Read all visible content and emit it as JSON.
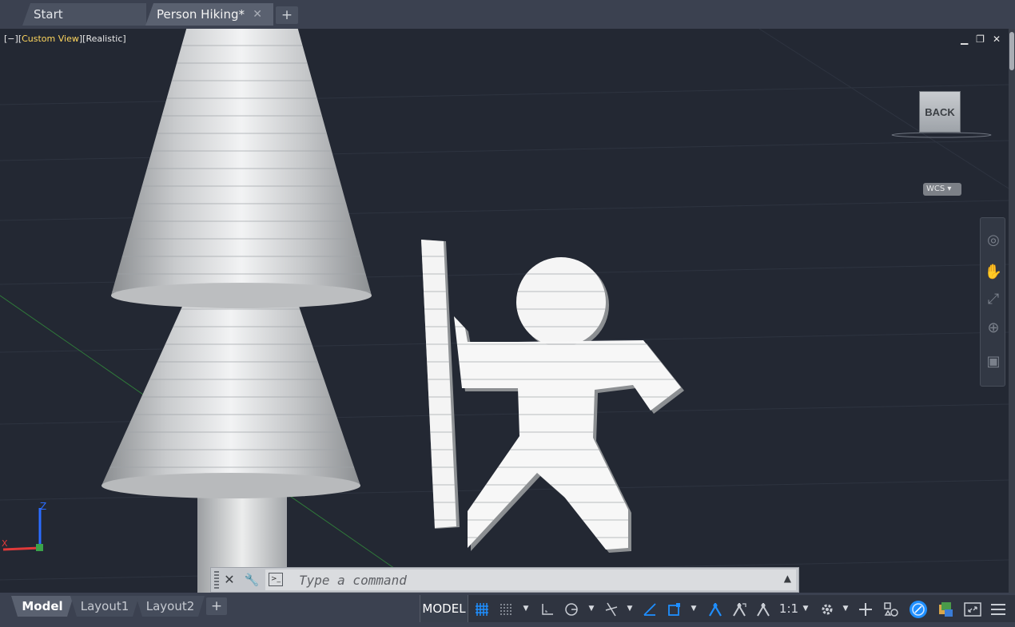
{
  "doc_tabs": {
    "start": "Start",
    "active": "Person Hiking*",
    "close_glyph": "✕",
    "new_glyph": "+"
  },
  "viewport": {
    "label_minus": "[−]",
    "label_view": "Custom View",
    "label_style": "[Realistic]",
    "viewcube_face": "BACK",
    "wcs_label": "WCS",
    "ucs_z": "Z",
    "ucs_x": "X"
  },
  "command_line": {
    "placeholder": "Type a command"
  },
  "layout_tabs": [
    "Model",
    "Layout1",
    "Layout2"
  ],
  "status_bar": {
    "space": "MODEL",
    "annotation_scale": "1:1"
  },
  "colors": {
    "accent": "#1f8fff",
    "viewport_bg": "#232833",
    "label_highlight": "#ffd75e"
  }
}
